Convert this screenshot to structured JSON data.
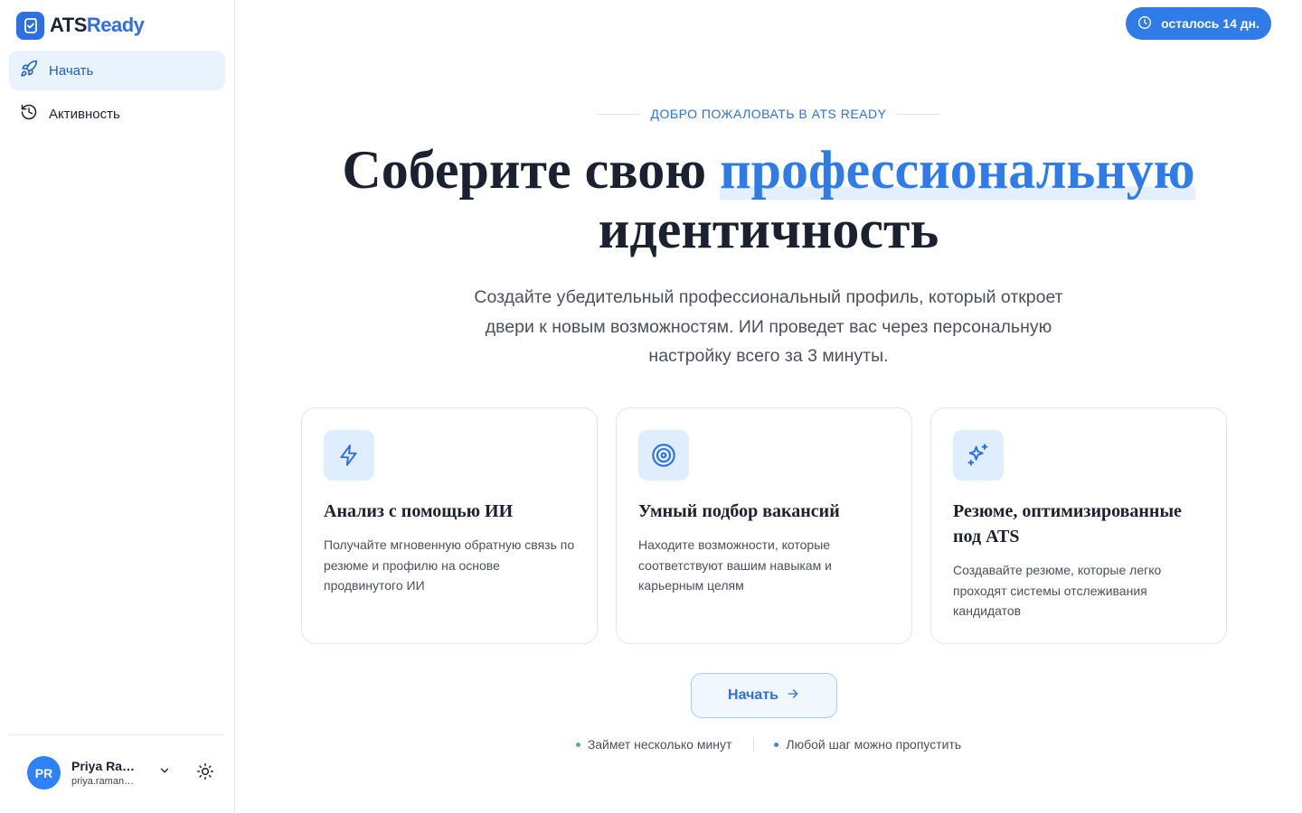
{
  "app": {
    "logo_part1": "ATS",
    "logo_part2": "Ready",
    "brand_color": "#2f6fe4"
  },
  "sidebar": {
    "items": [
      {
        "label": "Начать",
        "icon": "rocket-icon",
        "active": true
      },
      {
        "label": "Активность",
        "icon": "history-icon",
        "active": false
      }
    ]
  },
  "user": {
    "initials": "PR",
    "name": "Priya Ram...",
    "email": "priya.raman@..."
  },
  "trial": {
    "label": "осталось 14 дн.",
    "icon": "clock-icon"
  },
  "main": {
    "eyebrow": "ДОБРО ПОЖАЛОВАТЬ В ATS READY",
    "headline_part1": "Соберите свою ",
    "headline_highlight": "профессиональную",
    "headline_part2": "идентичность",
    "subtitle": "Создайте убедительный профессиональный профиль, который откроет двери к новым возможностям. ИИ проведет вас через персональную настройку всего за 3 минуты.",
    "cards": [
      {
        "icon": "lightning-icon",
        "title": "Анализ с помощью ИИ",
        "desc": "Получайте мгновенную обратную связь по резюме и профилю на основе продвинутого ИИ"
      },
      {
        "icon": "target-icon",
        "title": "Умный подбор вакансий",
        "desc": "Находите возможности, которые соответствуют вашим навыкам и карьерным целям"
      },
      {
        "icon": "sparkles-icon",
        "title": "Резюме, оптимизированные под ATS",
        "desc": "Создавайте резюме, которые легко проходят системы отслеживания кандидатов"
      }
    ],
    "cta_label": "Начать",
    "hints": [
      {
        "label": "Займет несколько минут",
        "dot_color": "#5aa98a"
      },
      {
        "label": "Любой шаг можно пропустить",
        "dot_color": "#3b82f6"
      }
    ]
  }
}
